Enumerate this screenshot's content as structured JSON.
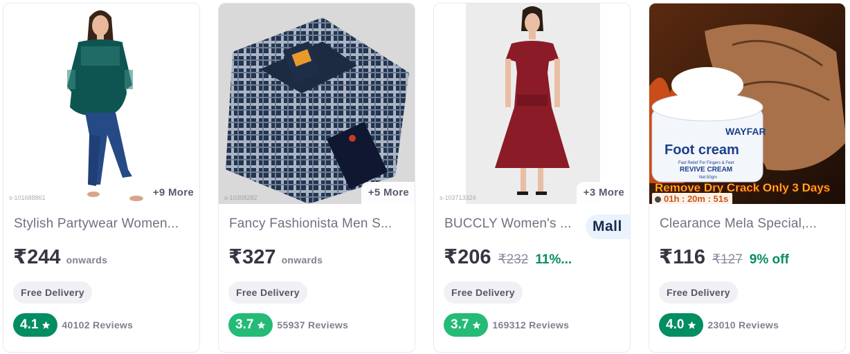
{
  "products": [
    {
      "title": "Stylish Partywear Women...",
      "more": "+9 More",
      "price": "₹244",
      "onwards": "onwards",
      "delivery": "Free Delivery",
      "rating": "4.1",
      "rating_color": "#038d63",
      "reviews": "40102 Reviews",
      "image": "woman-green-top-jeans",
      "watermark": "s-101688861"
    },
    {
      "title": "Fancy Fashionista Men S...",
      "more": "+5 More",
      "price": "₹327",
      "onwards": "onwards",
      "delivery": "Free Delivery",
      "rating": "3.7",
      "rating_color": "#23bb75",
      "reviews": "55937 Reviews",
      "image": "folded-checked-shirt",
      "watermark": "s-10308282"
    },
    {
      "title": "BUCCLY Women's ...",
      "more": "+3 More",
      "price": "₹206",
      "mrp": "₹232",
      "off": "11%...",
      "delivery": "Free Delivery",
      "rating": "3.7",
      "rating_color": "#23bb75",
      "reviews": "169312 Reviews",
      "image": "woman-maroon-dress",
      "mall_badge": "Mall",
      "watermark": "s-103713324"
    },
    {
      "title": "Clearance Mela Special,...",
      "price": "₹116",
      "mrp": "₹127",
      "off": "9% off",
      "delivery": "Free Delivery",
      "rating": "4.0",
      "rating_color": "#038d63",
      "reviews": "23010 Reviews",
      "image": "foot-cream-jar",
      "timer": "01h : 20m : 51s",
      "banner": "Remove Dry Crack  Only 3 Days",
      "brand": "WAYFAR",
      "jar_title": "Foot cream",
      "jar_sub": "Fast Relief For Fingers & Feet",
      "jar_name": "REVIVE CREAM",
      "jar_net": "Net.50gm"
    }
  ]
}
